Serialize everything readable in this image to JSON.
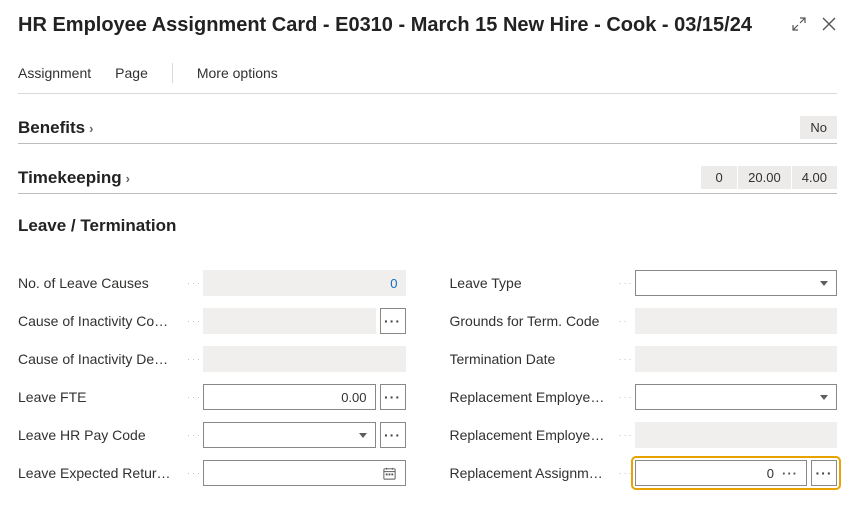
{
  "header": {
    "title": "HR Employee Assignment Card - E0310 - March 15  New Hire - Cook - 03/15/24"
  },
  "cmdbar": {
    "assignment": "Assignment",
    "page": "Page",
    "more": "More options"
  },
  "benefits": {
    "title": "Benefits",
    "tag_no": "No"
  },
  "timekeeping": {
    "title": "Timekeeping",
    "tag_a": "0",
    "tag_b": "20.00",
    "tag_c": "4.00"
  },
  "leave": {
    "title": "Leave / Termination",
    "left": {
      "no_leave_causes_label": "No. of Leave Causes",
      "no_leave_causes_value": "0",
      "cause_code_label": "Cause of Inactivity Co…",
      "cause_code_value": "",
      "cause_desc_label": "Cause of Inactivity De…",
      "cause_desc_value": "",
      "leave_fte_label": "Leave FTE",
      "leave_fte_value": "0.00",
      "leave_paycode_label": "Leave HR Pay Code",
      "leave_paycode_value": "",
      "leave_expected_label": "Leave Expected Retur…",
      "leave_expected_value": ""
    },
    "right": {
      "leave_type_label": "Leave Type",
      "leave_type_value": "",
      "grounds_label": "Grounds for Term. Code",
      "grounds_value": "",
      "term_date_label": "Termination Date",
      "term_date_value": "",
      "repl_emp_no_label": "Replacement Employe…",
      "repl_emp_no_value": "",
      "repl_emp_name_label": "Replacement Employe…",
      "repl_emp_name_value": "",
      "repl_assign_label": "Replacement Assignm…",
      "repl_assign_value": "0"
    }
  }
}
